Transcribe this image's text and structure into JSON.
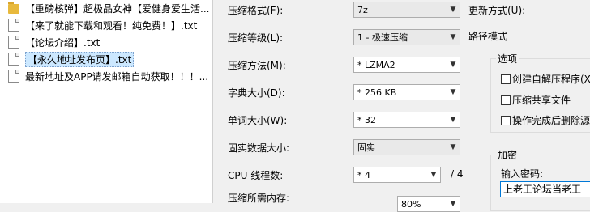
{
  "files": [
    {
      "name": "【重磅核弹】超极品女神【爱健身爱生活...",
      "type": "folder"
    },
    {
      "name": "【来了就能下载和观看！纯免费！】.txt",
      "type": "file"
    },
    {
      "name": "【论坛介绍】.txt",
      "type": "file"
    },
    {
      "name": "【永久地址发布页】.txt",
      "type": "file"
    },
    {
      "name": "最新地址及APP请发邮箱自动获取！！！...",
      "type": "file"
    }
  ],
  "form": {
    "format_label": "压缩格式(F):",
    "format_value": "7z",
    "level_label": "压缩等级(L):",
    "level_value": "1 - 极速压缩",
    "method_label": "压缩方法(M):",
    "method_value": "* LZMA2",
    "dict_label": "字典大小(D):",
    "dict_value": "* 256 KB",
    "word_label": "单词大小(W):",
    "word_value": "* 32",
    "solid_label": "固实数据大小:",
    "solid_value": "固实",
    "cpu_label": "CPU 线程数:",
    "cpu_value": "* 4",
    "cpu_total": "/ 4",
    "memory_label": "压缩所需内存:",
    "memory_value": "80%"
  },
  "right": {
    "update_label": "更新方式(U):",
    "path_label": "路径模式",
    "options_title": "选项",
    "options": [
      "创建自解压程序(X)",
      "压缩共享文件",
      "操作完成后删除源"
    ],
    "encrypt_title": "加密",
    "password_label": "输入密码:",
    "password_value": "上老王论坛当老王"
  }
}
